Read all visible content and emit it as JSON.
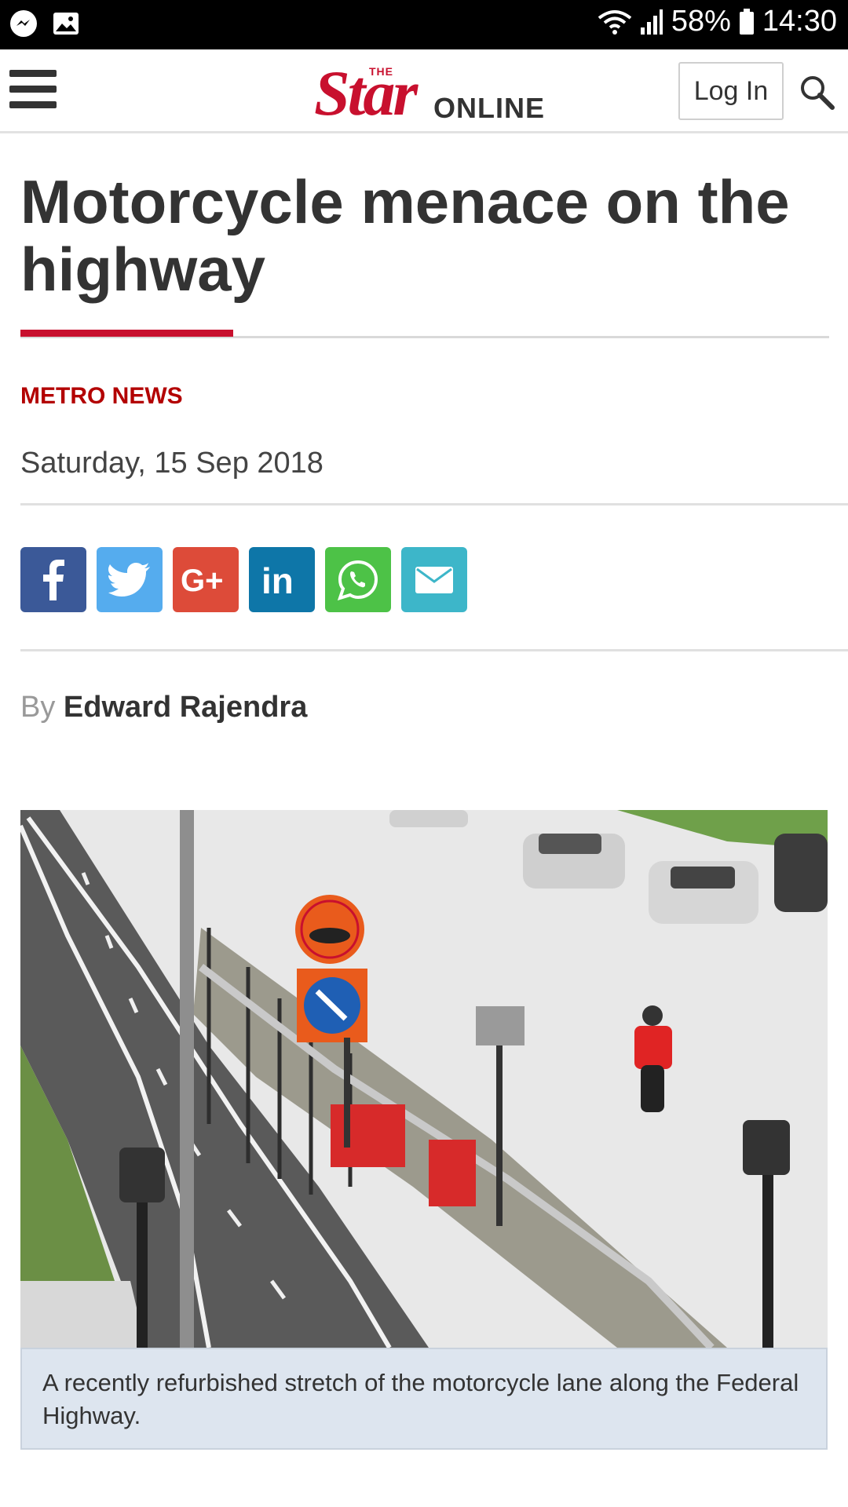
{
  "status_bar": {
    "battery": "58%",
    "time": "14:30",
    "icons": [
      "messenger-icon",
      "gallery-icon",
      "wifi-icon",
      "signal-icon",
      "battery-icon"
    ]
  },
  "header": {
    "logo_the": "THE",
    "logo_star": "Star",
    "logo_online": "ONLINE",
    "login_label": "Log In",
    "icons": [
      "hamburger-menu-icon",
      "search-icon"
    ]
  },
  "article": {
    "title": "Motorcycle menace on the highway",
    "category": "METRO NEWS",
    "date": "Saturday, 15 Sep 2018",
    "byline_prefix": "By",
    "author": "Edward Rajendra",
    "caption": "A recently refurbished stretch of the motorcycle lane along the Federal Highway."
  },
  "share": [
    {
      "name": "facebook",
      "color": "#3b5998"
    },
    {
      "name": "twitter",
      "color": "#55acee"
    },
    {
      "name": "google-plus",
      "color": "#dd4b39"
    },
    {
      "name": "linkedin",
      "color": "#0e76a8"
    },
    {
      "name": "whatsapp",
      "color": "#4dc247"
    },
    {
      "name": "email",
      "color": "#3db6c9"
    }
  ],
  "colors": {
    "brand_red": "#c8102e",
    "category_red": "#b30000",
    "caption_bg": "#dde5ef"
  }
}
